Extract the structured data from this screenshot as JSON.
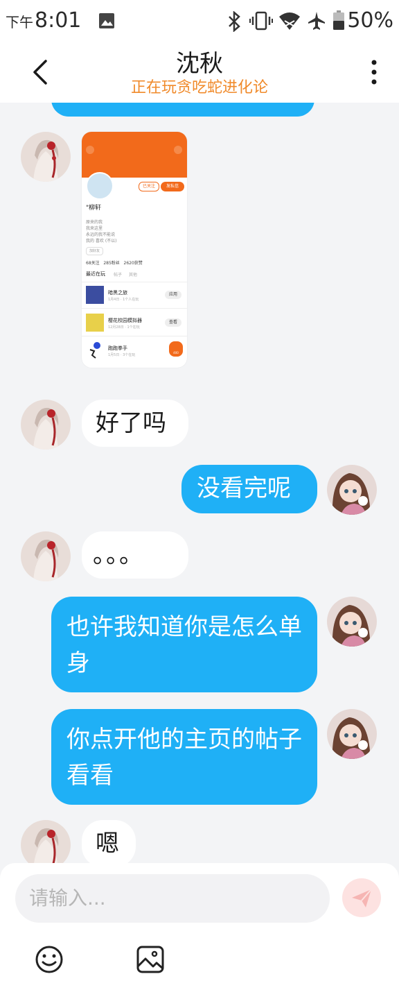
{
  "status_bar": {
    "time_prefix": "下午",
    "time": "8:01",
    "battery": "50%"
  },
  "header": {
    "title": "沈秋",
    "subtitle": "正在玩贪吃蛇进化论"
  },
  "screenshot_card": {
    "follow_label": "已关注",
    "chat_label": "发私信",
    "username": "\"柳轩",
    "bio_lines": [
      "原来的我",
      "我来这里",
      "永远的我不能说",
      "我的 喜欢 (不以)"
    ],
    "tag": "加好友",
    "stats": "68关注   285粉丝   2620获赞",
    "section_title": "最近在玩",
    "section_tabs": [
      "帖子",
      "其他"
    ],
    "games": [
      {
        "name": "暗黑之旅",
        "meta": "1月4日 · 1个人在玩",
        "action": "应用"
      },
      {
        "name": "樱花校园模拟器",
        "meta": "12月28日 · 1个在玩",
        "action": "查看"
      },
      {
        "name": "跑跑拳手",
        "meta": "1月5日 · 3个在玩",
        "action": "400"
      }
    ]
  },
  "messages": [
    {
      "side": "left",
      "text": "好了吗"
    },
    {
      "side": "right",
      "text": "没看完呢"
    },
    {
      "side": "left",
      "text": "。。。"
    },
    {
      "side": "right",
      "text": "也许我知道你是怎么单身"
    },
    {
      "side": "right",
      "text": "你点开他的主页的帖子看看"
    },
    {
      "side": "left",
      "text": "嗯"
    }
  ],
  "input": {
    "placeholder": "请输入..."
  },
  "icons": {
    "back": "chevron-left-icon",
    "more": "more-vertical-icon",
    "send": "send-icon",
    "emoji": "emoji-icon",
    "image": "image-icon"
  },
  "colors": {
    "bubble_right": "#1fb0f6",
    "bubble_left": "#ffffff",
    "subtitle": "#f08a2a",
    "background": "#f3f4f6"
  }
}
